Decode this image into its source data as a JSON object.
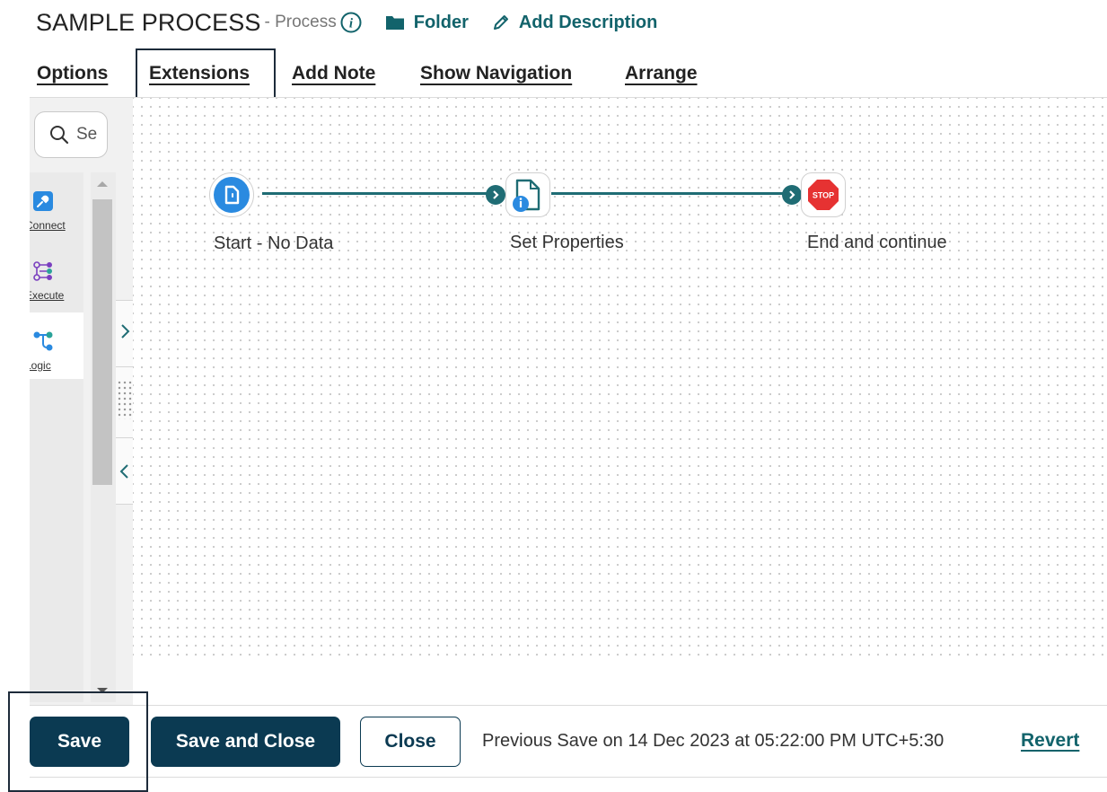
{
  "header": {
    "title": "SAMPLE PROCESS",
    "type_label": "- Process",
    "folder_label": "Folder",
    "add_description_label": "Add Description"
  },
  "tabs": [
    {
      "label": "Options"
    },
    {
      "label": "Extensions"
    },
    {
      "label": "Add Note"
    },
    {
      "label": "Show Navigation"
    },
    {
      "label": "Arrange"
    }
  ],
  "palette": {
    "search_value": "Se",
    "categories": [
      {
        "label": "Connect",
        "icon": "plug-icon"
      },
      {
        "label": "Execute",
        "icon": "execute-icon"
      },
      {
        "label": "Logic",
        "icon": "logic-icon"
      }
    ]
  },
  "canvas": {
    "nodes": [
      {
        "label": "Start - No Data",
        "icon": "start-document-icon"
      },
      {
        "label": "Set Properties",
        "icon": "set-properties-icon"
      },
      {
        "label": "End and continue",
        "icon": "stop-sign-icon",
        "badge": "STOP"
      }
    ]
  },
  "footer": {
    "save_label": "Save",
    "save_close_label": "Save and Close",
    "close_label": "Close",
    "previous_save_text": "Previous Save on 14 Dec 2023 at 05:22:00 PM UTC+5:30",
    "revert_label": "Revert"
  },
  "colors": {
    "accent": "#12636b",
    "primary_button": "#0b3a52",
    "connector": "#1f6c74",
    "stop": "#e63232",
    "node_blue": "#2a8ae0"
  }
}
